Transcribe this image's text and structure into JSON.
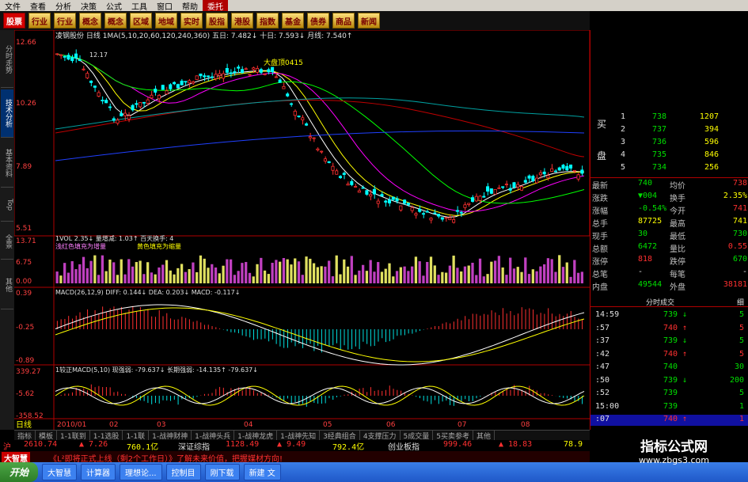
{
  "menu": [
    "文件",
    "查看",
    "分析",
    "决策",
    "公式",
    "工具",
    "窗口",
    "帮助",
    "委托"
  ],
  "toolbar": [
    "股票",
    "行业",
    "行业",
    "概念",
    "概念",
    "区域",
    "地域",
    "实时",
    "股指",
    "港股",
    "指数",
    "基金",
    "债券",
    "商品",
    "新闻"
  ],
  "left_tabs": [
    "分时走势",
    "技术分析",
    "基本资料",
    "Top",
    "全景",
    "其他"
  ],
  "chart": {
    "title_line": "凌钢股份 日线 1MA(5,10,20,60,120,240,360) 五日: 7.482↓ 十日: 7.593↓ 月线: 7.540↑",
    "yaxis_main": [
      "12.66",
      "10.26",
      "7.89",
      "5.51"
    ],
    "annotation": "大盘顶0415",
    "annotation2": "12.17",
    "vol_title": "1VOL 2.35↓ 量增减: 1.03↑ 百天换手: 4",
    "vol_legend1": "浅红色填充为增量",
    "vol_legend2": "黄色填充为缩量",
    "yaxis_vol": [
      "13.71",
      "6.75",
      "0.00"
    ],
    "macd_title": "MACD(26,12,9) DIFF: 0.144↓ DEA: 0.203↓ MACD: -0.117↓",
    "yaxis_macd": [
      "0.39",
      "-0.25",
      "-0.89"
    ],
    "ind_title": "1较正MACD(5,10) 现强弱: -79.637↓ 长期强弱: -14.135↑ -79.637↓",
    "yaxis_ind": [
      "339.27",
      "-5.62",
      "-358.52"
    ],
    "xaxis": [
      "2010/01",
      "02",
      "03",
      "04",
      "05",
      "06",
      "07",
      "08"
    ],
    "bottom_label": "日线"
  },
  "quote": {
    "side_buy": "买",
    "side_sell": "盘",
    "levels": [
      {
        "n": "1",
        "p": "738",
        "v": "1207"
      },
      {
        "n": "2",
        "p": "737",
        "v": "394"
      },
      {
        "n": "3",
        "p": "736",
        "v": "596"
      },
      {
        "n": "4",
        "p": "735",
        "v": "846"
      },
      {
        "n": "5",
        "p": "734",
        "v": "256"
      }
    ],
    "stats": [
      {
        "a": "最新",
        "av": "740",
        "b": "均价",
        "bv": "738"
      },
      {
        "a": "涨跌",
        "av": "▼004",
        "b": "换手",
        "bv": "2.35%"
      },
      {
        "a": "涨幅",
        "av": "-0.54%",
        "b": "今开",
        "bv": "741"
      },
      {
        "a": "总手",
        "av": "87725",
        "b": "最高",
        "bv": "741"
      },
      {
        "a": "现手",
        "av": "30",
        "b": "最低",
        "bv": "730"
      },
      {
        "a": "总额",
        "av": "6472",
        "b": "量比",
        "bv": "0.55"
      },
      {
        "a": "涨停",
        "av": "818",
        "b": "跌停",
        "bv": "670"
      },
      {
        "a": "总笔",
        "av": "-",
        "b": "每笔",
        "bv": "-"
      },
      {
        "a": "内盘",
        "av": "49544",
        "b": "外盘",
        "bv": "38181"
      }
    ],
    "ticks_header": "分时成交",
    "ticks_header2": "细",
    "ticks": [
      {
        "t": "14:59",
        "p": "739",
        "d": "↓",
        "v": "5"
      },
      {
        "t": ":57",
        "p": "740",
        "d": "↑",
        "v": "5"
      },
      {
        "t": ":37",
        "p": "739",
        "d": "↓",
        "v": "5"
      },
      {
        "t": ":42",
        "p": "740",
        "d": "↑",
        "v": "5"
      },
      {
        "t": ":47",
        "p": "740",
        "d": "",
        "v": "30"
      },
      {
        "t": ":50",
        "p": "739",
        "d": "↓",
        "v": "200"
      },
      {
        "t": ":52",
        "p": "739",
        "d": "",
        "v": "5"
      },
      {
        "t": "15:00",
        "p": "739",
        "d": "",
        "v": "1"
      },
      {
        "t": ":07",
        "p": "740",
        "d": "↑",
        "v": "1"
      }
    ]
  },
  "bottom_tabs": [
    "指标",
    "模板",
    "1-1联到",
    "1-1选股",
    "1-1联",
    "1-战神财神",
    "1-战神头兵",
    "1-战神龙虎",
    "1-战神先知",
    "3经典组合",
    "4支撑压力",
    "5成交量",
    "5买卖参考",
    "其他"
  ],
  "ticker": {
    "sh_label": "沪",
    "sh_val": "2610.74",
    "sh_chg": "▲ 7.26",
    "sh_amt": "760.1亿",
    "sz_label": "深证综指",
    "sz_val": "1128.49",
    "sz_chg": "▲ 9.49",
    "sz_amt": "792.4亿",
    "cy_label": "创业板指",
    "cy_val": "999.46",
    "cy_chg": "▲ 18.83",
    "last": "78.9"
  },
  "scroller": {
    "brand": "大智慧",
    "msg": "《L²即将正式上线（剩2个工作日）》了解未来价值，把握媒材方向!"
  },
  "taskbar": {
    "start": "开始",
    "tasks": [
      "大智慧",
      "计算器",
      "理想论...",
      "控制目",
      "刚下载",
      "新建 文"
    ]
  },
  "watermark": {
    "l1": "指标公式网",
    "l2": "www.zbgs3.com"
  },
  "colors": {
    "up": "#ff3030",
    "down": "#00e000",
    "axis": "#b00000"
  }
}
